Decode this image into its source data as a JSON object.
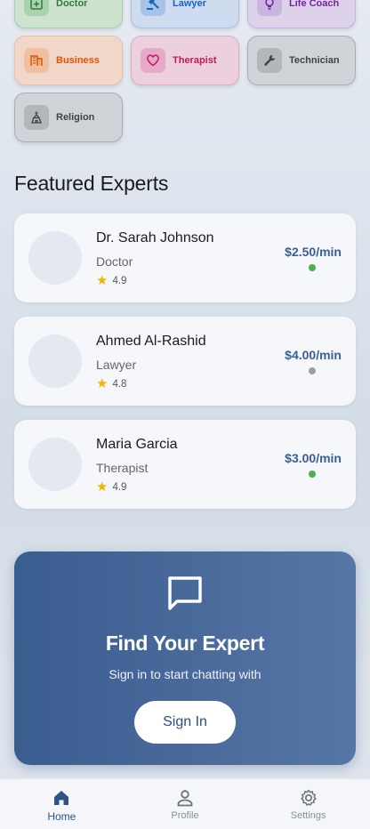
{
  "categories": [
    {
      "label": "Doctor",
      "icon": "medical-plus-icon",
      "color": "#2e7d32"
    },
    {
      "label": "Lawyer",
      "icon": "gavel-icon",
      "color": "#1565c0"
    },
    {
      "label": "Life Coach",
      "icon": "lightbulb-icon",
      "color": "#7b1fa2"
    },
    {
      "label": "Business",
      "icon": "building-icon",
      "color": "#e65100"
    },
    {
      "label": "Therapist",
      "icon": "heart-icon",
      "color": "#c2185b"
    },
    {
      "label": "Technician",
      "icon": "wrench-icon",
      "color": "#424242"
    },
    {
      "label": "Religion",
      "icon": "temple-icon",
      "color": "#424242"
    }
  ],
  "featured": {
    "title": "Featured Experts",
    "experts": [
      {
        "name": "Dr. Sarah Johnson",
        "role": "Doctor",
        "rating": "4.9",
        "price": "$2.50/min",
        "status_color": "#4caf50"
      },
      {
        "name": "Ahmed Al-Rashid",
        "role": "Lawyer",
        "rating": "4.8",
        "price": "$4.00/min",
        "status_color": "#9e9e9e"
      },
      {
        "name": "Maria Garcia",
        "role": "Therapist",
        "rating": "4.9",
        "price": "$3.00/min",
        "status_color": "#4caf50"
      }
    ]
  },
  "cta": {
    "icon": "chat-bubble-icon",
    "title": "Find Your Expert",
    "subtitle": "Sign in to start chatting with",
    "button": "Sign In"
  },
  "nav": {
    "items": [
      {
        "label": "Home",
        "icon": "home-icon",
        "active": true
      },
      {
        "label": "Profile",
        "icon": "person-icon",
        "active": false
      },
      {
        "label": "Settings",
        "icon": "gear-icon",
        "active": false
      }
    ]
  },
  "colors": {
    "accent": "#2f5287",
    "cta_gradient_start": "#3a5d8f",
    "cta_gradient_end": "#5577a6",
    "star": "#f4b400"
  }
}
